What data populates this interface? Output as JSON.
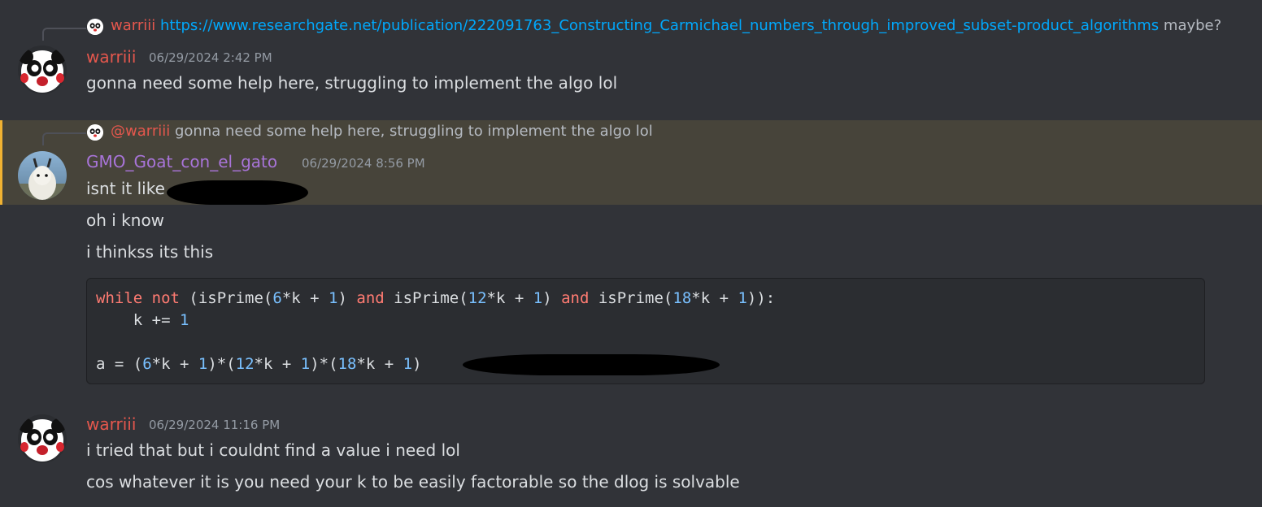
{
  "colors": {
    "background": "#313338",
    "mention_highlight": "#47443a",
    "mention_bar": "#f0b232",
    "username_warriii": "#e4574d",
    "username_goat": "#a874d8",
    "link": "#00a8fc"
  },
  "message1": {
    "reply": {
      "author": "warriii",
      "link": "https://www.researchgate.net/publication/222091763_Constructing_Carmichael_numbers_through_improved_subset-product_algorithms",
      "suffix": "maybe?"
    },
    "author": "warriii",
    "timestamp": "06/29/2024 2:42 PM",
    "text": "gonna need some help here, struggling to implement the algo lol",
    "avatar_icon": "panda-avatar"
  },
  "message2": {
    "reply": {
      "mention": "@warriii",
      "text": "gonna need some help here, struggling to implement the algo lol"
    },
    "author": "GMO_Goat_con_el_gato",
    "timestamp": "06/29/2024 8:56 PM",
    "text": "isnt it like",
    "avatar_icon": "goat-avatar"
  },
  "followups": {
    "line1": "oh i know",
    "line2": "i thinkss its this"
  },
  "code_block": {
    "line1": {
      "t1": "while",
      "t2": " ",
      "t3": "not",
      "t4": " (isPrime(",
      "t5": "6",
      "t6": "*k + ",
      "t7": "1",
      "t8": ") ",
      "t9": "and",
      "t10": " isPrime(",
      "t11": "12",
      "t12": "*k + ",
      "t13": "1",
      "t14": ") ",
      "t15": "and",
      "t16": " isPrime(",
      "t17": "18",
      "t18": "*k + ",
      "t19": "1",
      "t20": ")):"
    },
    "line2": {
      "t1": "    k += ",
      "t2": "1"
    },
    "line3": {
      "t1": "a = (",
      "t2": "6",
      "t3": "*k + ",
      "t4": "1",
      "t5": ")*(",
      "t6": "12",
      "t7": "*k + ",
      "t8": "1",
      "t9": ")*(",
      "t10": "18",
      "t11": "*k + ",
      "t12": "1",
      "t13": ")"
    }
  },
  "message3": {
    "author": "warriii",
    "timestamp": "06/29/2024 11:16 PM",
    "text1": "i tried that but i couldnt find a value i need lol",
    "text2": "cos whatever it is you need your k to be easily factorable so the dlog is solvable",
    "avatar_icon": "panda-avatar"
  }
}
